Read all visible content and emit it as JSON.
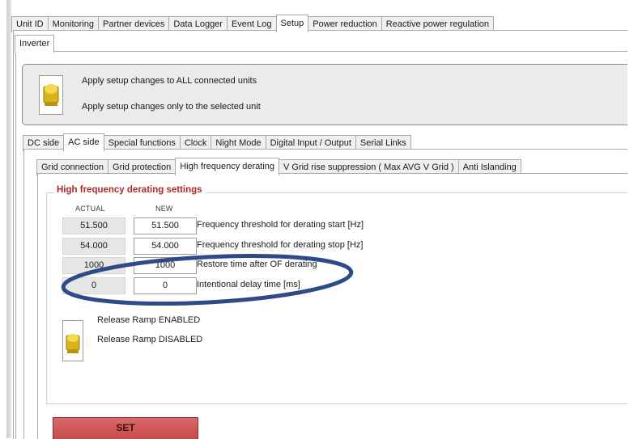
{
  "main_tabs": [
    "Unit ID",
    "Monitoring",
    "Partner devices",
    "Data Logger",
    "Event Log",
    "Setup",
    "Power reduction",
    "Reactive power regulation"
  ],
  "main_tab_active": "Setup",
  "inverter_tab": "Inverter",
  "apply": {
    "option_all": "Apply setup changes to ALL connected units",
    "option_selected": "Apply setup changes only to the selected unit"
  },
  "sub_tabs": [
    "DC side",
    "AC side",
    "Special functions",
    "Clock",
    "Night Mode",
    "Digital Input / Output",
    "Serial Links"
  ],
  "sub_tab_active": "AC side",
  "hf_tabs": [
    "Grid connection",
    "Grid protection",
    "High frequency derating",
    "V Grid rise suppression ( Max AVG V Grid )",
    "Anti Islanding"
  ],
  "hf_tab_active": "High frequency derating",
  "settings": {
    "group_title": "High frequency derating settings",
    "col_actual": "ACTUAL",
    "col_new": "NEW",
    "rows": [
      {
        "actual": "51.500",
        "new": "51.500",
        "label": "Frequency threshold for derating start [Hz]"
      },
      {
        "actual": "54.000",
        "new": "54.000",
        "label": "Frequency threshold for derating stop [Hz]"
      },
      {
        "actual": "1000",
        "new": "1000",
        "label": "Restore time after OF derating"
      },
      {
        "actual": "0",
        "new": "0",
        "label": "Intentional delay time [ms]"
      }
    ]
  },
  "ramp": {
    "option_enabled": "Release Ramp ENABLED",
    "option_disabled": "Release Ramp DISABLED"
  },
  "set_button": "SET",
  "colors": {
    "group_title": "#b02a2a",
    "set_button": "#d05a5a",
    "highlight_ellipse": "#2f4a8a",
    "toggle_icon": "#d8b418"
  }
}
